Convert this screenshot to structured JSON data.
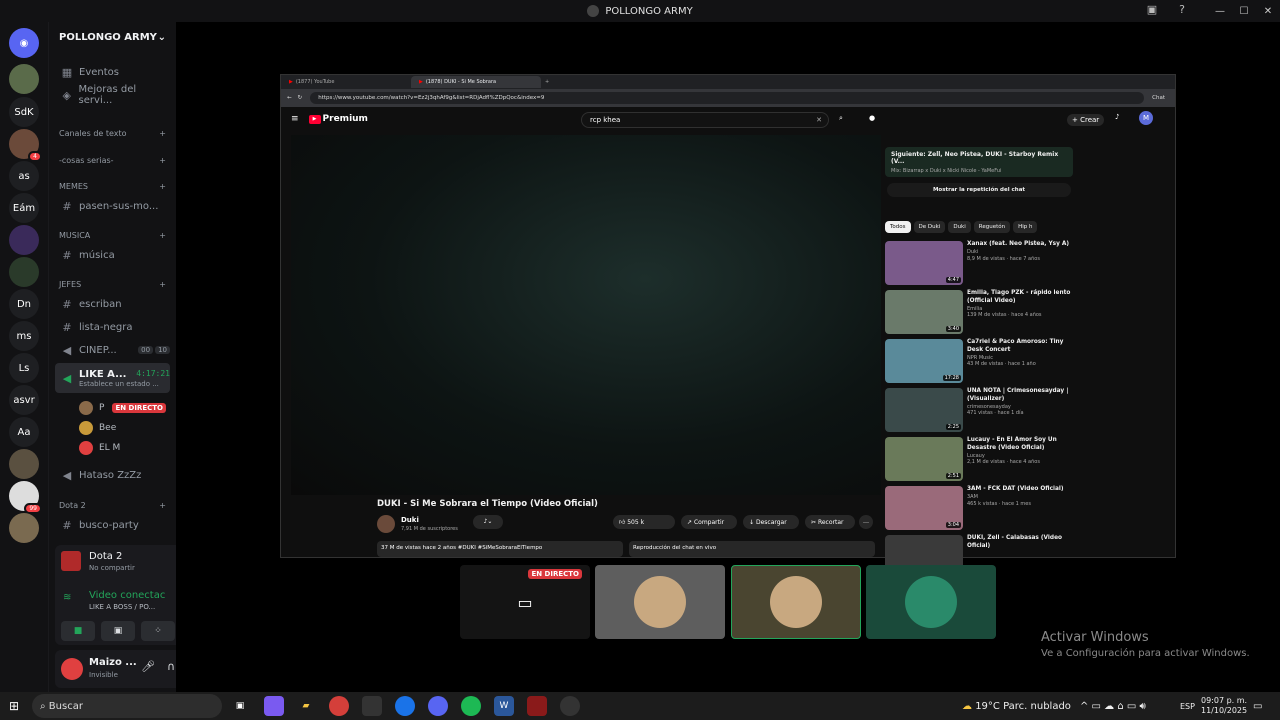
{
  "window": {
    "title": "POLLONGO ARMY"
  },
  "guilds": [
    {
      "label": "",
      "color": "#5a6b4a"
    },
    {
      "label": "SdK",
      "color": "#1e1f22"
    },
    {
      "label": "",
      "color": "#6b4a3a",
      "badge": "4"
    },
    {
      "label": "as",
      "color": "#1e1f22"
    },
    {
      "label": "Eám",
      "color": "#1e1f22"
    },
    {
      "label": "",
      "color": "#3a2a5a"
    },
    {
      "label": "",
      "color": "#2a3a2a"
    },
    {
      "label": "Dn",
      "color": "#1e1f22"
    },
    {
      "label": "ms",
      "color": "#1e1f22"
    },
    {
      "label": "Ls",
      "color": "#1e1f22"
    },
    {
      "label": "asvr",
      "color": "#1e1f22"
    },
    {
      "label": "Aa",
      "color": "#1e1f22"
    },
    {
      "label": "",
      "color": "#5a5040"
    },
    {
      "label": "",
      "color": "#ddd",
      "badge": "99"
    },
    {
      "label": "",
      "color": "#7a6a50"
    }
  ],
  "server": {
    "name": "POLLONGO ARMY",
    "events": "Eventos",
    "boosts": "Mejoras del servi...",
    "categories": {
      "text": "Canales de texto",
      "serious": "-cosas serias-",
      "memes": "MEMES",
      "music": "MUSICA",
      "bosses": "JEFES",
      "dota": "Dota 2"
    },
    "channels": {
      "pasen": "pasen-sus-mo...",
      "musica": "música",
      "escriban": "escriban",
      "lista": "lista-negra",
      "cinema": "CINEP...",
      "cinema_count_a": "00",
      "cinema_count_b": "10",
      "like": "LIKE A...",
      "like_timer": "4:17:21",
      "like_status": "Establece un estado ...",
      "hataso": "Hataso ZzZz",
      "busco": "busco-party"
    },
    "voice_users": [
      {
        "name": "P",
        "live": "EN DIRECTO",
        "color": "#8a6a4a"
      },
      {
        "name": "Bee",
        "live": "",
        "color": "#c89a3a"
      },
      {
        "name": "EL M",
        "live": "",
        "color": "#e04040"
      }
    ]
  },
  "voice_panel": {
    "game": "Dota 2",
    "game_sub": "No compartir",
    "status": "Video conectac",
    "channel": "LIKE A BOSS / PO..."
  },
  "user_panel": {
    "name": "Maizo ...",
    "status": "Invisible"
  },
  "browser": {
    "tabs": [
      "(1877) YouTube",
      "(1878) DUKI - Si Me Sobrara"
    ],
    "url": "https://www.youtube.com/watch?v=Ez2j3qhAf9g&list=RDjAdfl%ZDpQoc&index=9",
    "chat_label": "Chat"
  },
  "youtube": {
    "logo": "Premium",
    "search": "rcp khea",
    "create": "+ Crear",
    "video_title": "DUKI - Si Me Sobrara el Tiempo (Video Oficial)",
    "channel": "Duki",
    "subs": "7,91 M de suscriptores",
    "likes": "505 k",
    "share": "Compartir",
    "download": "Descargar",
    "clip": "Recortar",
    "views": "37 M de vistas  hace 2 años  #DUKI #SiMeSobraraElTiempo",
    "chat_replay": "Reproducción del chat en vivo",
    "next_title": "Siguiente: Zell, Neo Pistea, DUKI - Starboy Remix (V...",
    "next_sub": "Mix: Bizarrap x Duki x Nicki Nicole - YaMeFui",
    "show_chat": "Mostrar la repetición del chat",
    "chips": [
      "Todos",
      "De Duki",
      "Duki",
      "Reguetón",
      "Hip h"
    ],
    "recs": [
      {
        "title": "Xanax (feat. Neo Pistea, Ysy A)",
        "ch": "Duki",
        "meta": "8,9 M de vistas · hace 7 años",
        "dur": "4:47",
        "color": "#7a5a8a"
      },
      {
        "title": "Emilia, Tiago PZK - rápido lento (Official Video)",
        "ch": "Emilia",
        "meta": "139 M de vistas · hace 4 años",
        "dur": "3:40",
        "color": "#6a7a6a"
      },
      {
        "title": "Ca7riel & Paco Amoroso: Tiny Desk Concert",
        "ch": "NPR Music",
        "meta": "43 M de vistas · hace 1 año",
        "dur": "17:28",
        "color": "#5a8a9a"
      },
      {
        "title": "UNA NOTA | Crimesonesayday | (Visualizer)",
        "ch": "crimesonesayday",
        "meta": "471 vistas · hace 1 día",
        "dur": "2:25",
        "color": "#3a4a4a"
      },
      {
        "title": "Lucauy - En El Amor Soy Un Desastre (Video Oficial)",
        "ch": "Lucauy",
        "meta": "2,1 M de vistas · hace 4 años",
        "dur": "2:51",
        "color": "#6a7a5a"
      },
      {
        "title": "3AM - FCK DAT (Video Oficial)",
        "ch": "3AM",
        "meta": "465 k vistas · hace 1 mes",
        "dur": "3:04",
        "color": "#9a6a7a"
      },
      {
        "title": "DUKI, Zell - Calabasas (Video Oficial)",
        "ch": "",
        "meta": "",
        "dur": "",
        "color": "#3a3a3a"
      }
    ]
  },
  "tiles": [
    {
      "label": "EN DIRECTO",
      "color": "#141414"
    },
    {
      "label": "",
      "color": "#5e5e5e"
    },
    {
      "label": "",
      "color": "#4a4530"
    },
    {
      "label": "",
      "color": "#1a4a3a"
    }
  ],
  "activation": {
    "title": "Activar Windows",
    "sub": "Ve a Configuración para activar Windows."
  },
  "taskbar": {
    "search": "Buscar",
    "weather": "19°C  Parc. nublado",
    "lang": "ESP",
    "time": "09:07 p. m.",
    "date": "11/10/2025"
  }
}
